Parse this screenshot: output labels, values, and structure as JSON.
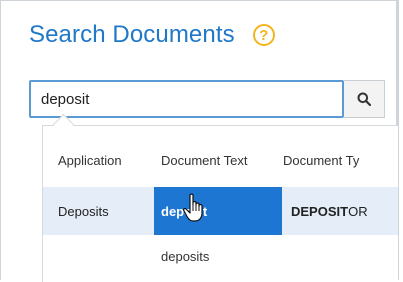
{
  "panel": {
    "title": "Search Documents",
    "help_icon": "?"
  },
  "search": {
    "value": "deposit",
    "button_icon": "search-icon"
  },
  "dropdown": {
    "columns": [
      "Application",
      "Document Text",
      "Document Ty"
    ],
    "selected_row": {
      "application": "Deposits",
      "document_text": "deposit",
      "document_type_prefix": "DEPOSIT",
      "document_type_suffix": "OR"
    },
    "other_rows": [
      "deposits"
    ]
  },
  "colors": {
    "title": "#1f78c8",
    "help": "#f2b51f",
    "selected_bg": "#1d77d2",
    "row_bg": "#e4edf8"
  }
}
